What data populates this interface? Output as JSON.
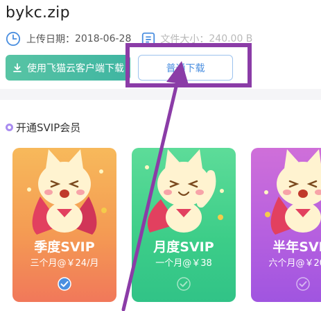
{
  "file": {
    "name": "bykc.zip"
  },
  "meta": {
    "upload_label": "上传日期：",
    "upload_date": "2018-06-28",
    "size_label": "文件大小：",
    "size_value": "240.00 B"
  },
  "buttons": {
    "client_download": "使用飞猫云客户端下载",
    "normal_download": "普通下载"
  },
  "svip": {
    "section_title": "开通SVIP会员",
    "plans": [
      {
        "name": "季度SVIP",
        "price": "三个月@￥24/月",
        "selected": true
      },
      {
        "name": "月度SVIP",
        "price": "一个月@￥38",
        "selected": false
      },
      {
        "name": "半年SVIP",
        "price": "六个月@￥20/月",
        "selected": false
      }
    ]
  },
  "colors": {
    "accent_green": "#3fb5a2",
    "accent_blue": "#4b8fe0",
    "annotation_purple": "#8b3ca7"
  },
  "icons": [
    "clock-icon",
    "file-size-icon",
    "download-icon",
    "ring-icon",
    "check-circle-icon"
  ]
}
